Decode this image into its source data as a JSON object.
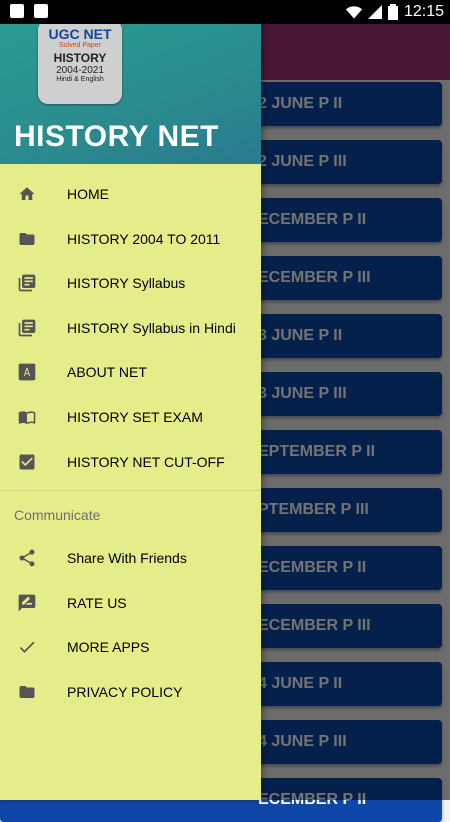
{
  "status_bar": {
    "time": "12:15"
  },
  "background_list": [
    "2 JUNE P II",
    "2 JUNE P III",
    "ECEMBER P II",
    "ECEMBER P III",
    "3 JUNE P II",
    "3 JUNE P III",
    "EPTEMBER P II",
    "PTEMBER P III",
    "ECEMBER P II",
    "ECEMBER P III",
    "4 JUNE P II",
    "4 JUNE P III",
    "ECEMBER P II"
  ],
  "drawer": {
    "logo": {
      "line1": "UGC NET",
      "line2": "Solved Paper",
      "line3": "HISTORY",
      "line4": "2004-2021",
      "line5": "Hindi & English"
    },
    "title": "HISTORY NET",
    "items": [
      {
        "label": "HOME",
        "icon": "home-icon"
      },
      {
        "label": " HISTORY 2004 TO 2011",
        "icon": "folder-icon"
      },
      {
        "label": "HISTORY Syllabus",
        "icon": "library-books-icon"
      },
      {
        "label": "HISTORY Syllabus in Hindi",
        "icon": "library-books-icon"
      },
      {
        "label": "ABOUT NET",
        "icon": "font-a-icon"
      },
      {
        "label": "HISTORY SET EXAM",
        "icon": "book-open-icon"
      },
      {
        "label": "HISTORY NET CUT-OFF",
        "icon": "checkbox-icon"
      }
    ],
    "section_header": "Communicate",
    "communicate_items": [
      {
        "label": "Share With Friends",
        "icon": "share-icon"
      },
      {
        "label": "RATE US",
        "icon": "rate-review-icon"
      },
      {
        "label": "MORE APPS",
        "icon": "check-icon"
      },
      {
        "label": "PRIVACY POLICY",
        "icon": "folder-icon"
      }
    ]
  }
}
